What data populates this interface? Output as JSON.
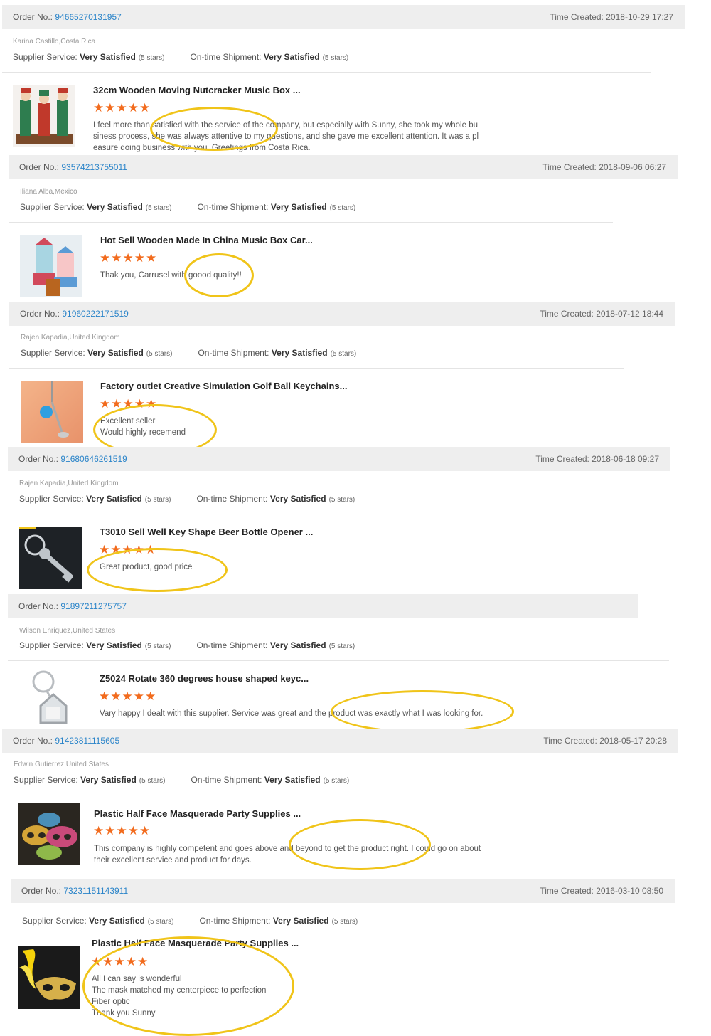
{
  "labels": {
    "order_no": "Order No.:",
    "time_created": "Time Created:",
    "supplier_service": "Supplier Service:",
    "ontime_shipment": "On-time Shipment:"
  },
  "colors": {
    "link": "#2a84c9",
    "star": "#f26b1d",
    "highlight": "#f0c419",
    "header_bg": "#eeeeee"
  },
  "orders": [
    {
      "order_no": "94665270131957",
      "time": "2018-10-29 17:27",
      "buyer": "Karina Castillo,Costa Rica",
      "supplier_rating": "Very Satisfied",
      "supplier_stars": "(5 stars)",
      "shipment_rating": "Very Satisfied",
      "shipment_stars": "(5 stars)",
      "product_title": "32cm Wooden Moving Nutcracker Music Box ...",
      "stars": "★★★★★",
      "review": "I feel more than satisfied with the service of the company, but especially with Sunny, she took my whole bu\nsiness process, she was always attentive to my questions, and she gave me excellent attention. It was a pl\neasure doing business with you. Greetings from Costa Rica.",
      "thumb_icon": "nutcracker-image"
    },
    {
      "order_no": "93574213755011",
      "time": "2018-09-06 06:27",
      "buyer": "Iliana Alba,Mexico",
      "supplier_rating": "Very Satisfied",
      "supplier_stars": "(5 stars)",
      "shipment_rating": "Very Satisfied",
      "shipment_stars": "(5 stars)",
      "product_title": "Hot Sell Wooden Made In China Music Box Car...",
      "stars": "★★★★★",
      "review": "Thak you, Carrusel with goood quality!!",
      "thumb_icon": "carousel-music-box-image"
    },
    {
      "order_no": "91960222171519",
      "time": "2018-07-12 18:44",
      "buyer": "Rajen Kapadia,United Kingdom",
      "supplier_rating": "Very Satisfied",
      "supplier_stars": "(5 stars)",
      "shipment_rating": "Very Satisfied",
      "shipment_stars": "(5 stars)",
      "product_title": "Factory outlet Creative Simulation Golf Ball Keychains...",
      "stars": "★★★★★",
      "review": "Excellent seller\nWould highly recemend",
      "thumb_icon": "golf-keychain-image"
    },
    {
      "order_no": "91680646261519",
      "time": "2018-06-18 09:27",
      "buyer": "Rajen Kapadia,United Kingdom",
      "supplier_rating": "Very Satisfied",
      "supplier_stars": "(5 stars)",
      "shipment_rating": "Very Satisfied",
      "shipment_stars": "(5 stars)",
      "product_title": "T3010 Sell Well Key Shape Beer Bottle Opener ...",
      "stars": "★★★★★",
      "review": "Great product, good price",
      "thumb_icon": "key-bottle-opener-image"
    },
    {
      "order_no": "91897211275757",
      "time": "",
      "buyer": "Wilson Enriquez,United States",
      "supplier_rating": "Very Satisfied",
      "supplier_stars": "(5 stars)",
      "shipment_rating": "Very Satisfied",
      "shipment_stars": "(5 stars)",
      "product_title": "Z5024 Rotate 360 degrees house shaped keyc...",
      "stars": "★★★★★",
      "review": "Vary happy I dealt with this supplier. Service was great and the product was exactly what I was looking for.",
      "thumb_icon": "house-keychain-image"
    },
    {
      "order_no": "91423811115605",
      "time": "2018-05-17 20:28",
      "buyer": "Edwin Gutierrez,United States",
      "supplier_rating": "Very Satisfied",
      "supplier_stars": "(5 stars)",
      "shipment_rating": "Very Satisfied",
      "shipment_stars": "(5 stars)",
      "product_title": "Plastic Half Face Masquerade Party Supplies ...",
      "stars": "★★★★★",
      "review": "This company is highly competent and goes above and beyond to get the product right. I could go on about\ntheir excellent service and product for days.",
      "thumb_icon": "masquerade-masks-image"
    },
    {
      "order_no": "73231151143911",
      "time": "2016-03-10 08:50",
      "buyer": "",
      "supplier_rating": "Very Satisfied",
      "supplier_stars": "(5 stars)",
      "shipment_rating": "Very Satisfied",
      "shipment_stars": "(5 stars)",
      "product_title": "Plastic Half Face Masquerade Party Supplies ...",
      "stars": "★★★★★",
      "review": "All I  can say is wonderful\nThe mask matched my centerpiece to perfection\nFiber optic\nThank you Sunny",
      "thumb_icon": "feather-mask-image"
    }
  ]
}
